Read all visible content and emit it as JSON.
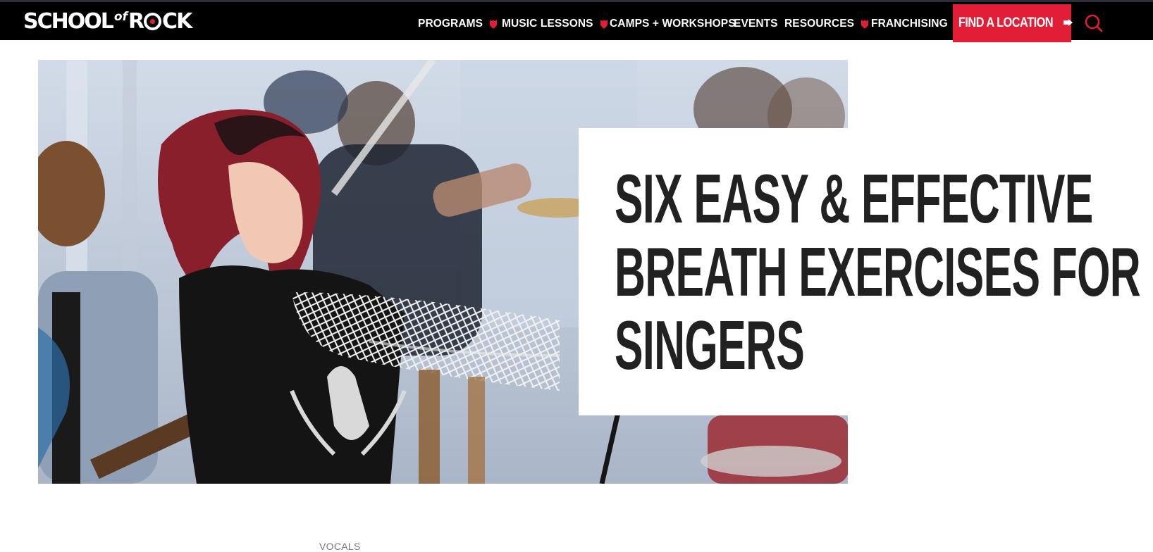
{
  "brand": {
    "name_left": "SCHOOL",
    "name_of": "of",
    "name_right_r": "R",
    "name_right_ck": "CK"
  },
  "nav": {
    "items": [
      {
        "label": "PROGRAMS",
        "dropdown": true
      },
      {
        "label": "MUSIC LESSONS",
        "dropdown": true
      },
      {
        "label": "CAMPS + WORKSHOPS",
        "dropdown": false
      },
      {
        "label": "EVENTS",
        "dropdown": false
      },
      {
        "label": "RESOURCES",
        "dropdown": true
      },
      {
        "label": "FRANCHISING",
        "dropdown": false
      }
    ],
    "cta_label": "FIND A LOCATION",
    "cta_icon": "arrow-right-icon",
    "search_icon": "search-icon"
  },
  "hero": {
    "image": "girl-singer-on-stage-photo",
    "title_lines": [
      "SIX EASY & EFFECTIVE",
      "BREATH EXERCISES FOR",
      "SINGERS"
    ]
  },
  "article": {
    "category": "VOCALS"
  },
  "colors": {
    "brand_red": "#e21e36",
    "nav_bg": "#000000",
    "title_text": "#212121"
  }
}
